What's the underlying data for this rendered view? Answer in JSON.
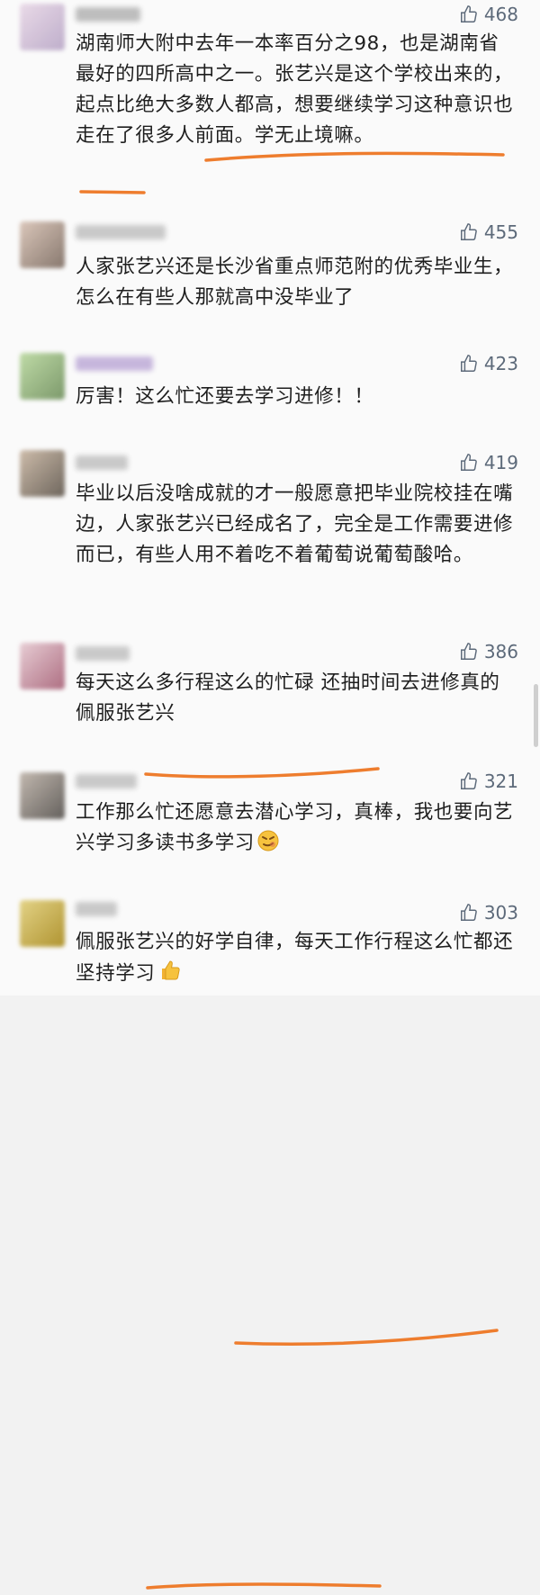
{
  "comments": [
    {
      "likes": "468",
      "text": "湖南师大附中去年一本率百分之98，也是湖南省最好的四所高中之一。张艺兴是这个学校出来的，起点比绝大多数人都高，想要继续学习这种意识也走在了很多人前面。学无止境嘛。"
    },
    {
      "likes": "455",
      "text": "人家张艺兴还是长沙省重点师范附的优秀毕业生，怎么在有些人那就高中没毕业了"
    },
    {
      "likes": "423",
      "text": "厉害！这么忙还要去学习进修！！"
    },
    {
      "likes": "419",
      "text": "毕业以后没啥成就的才一般愿意把毕业院校挂在嘴边，人家张艺兴已经成名了，完全是工作需要进修而已，有些人用不着吃不着葡萄说葡萄酸哈。"
    },
    {
      "likes": "386",
      "text": "每天这么多行程这么的忙碌 还抽时间去进修真的佩服张艺兴"
    },
    {
      "likes": "321",
      "text": "工作那么忙还愿意去潜心学习，真棒，我也要向艺兴学习多读书多学习",
      "emoji": "smirk-face-icon"
    },
    {
      "likes": "303",
      "text": "佩服张艺兴的好学自律，每天工作行程这么忙都还坚持学习",
      "emoji": "thumbs-up-emoji-icon"
    }
  ],
  "colors": {
    "underline": "#ee7d2e",
    "like": "#5d6a7a"
  }
}
